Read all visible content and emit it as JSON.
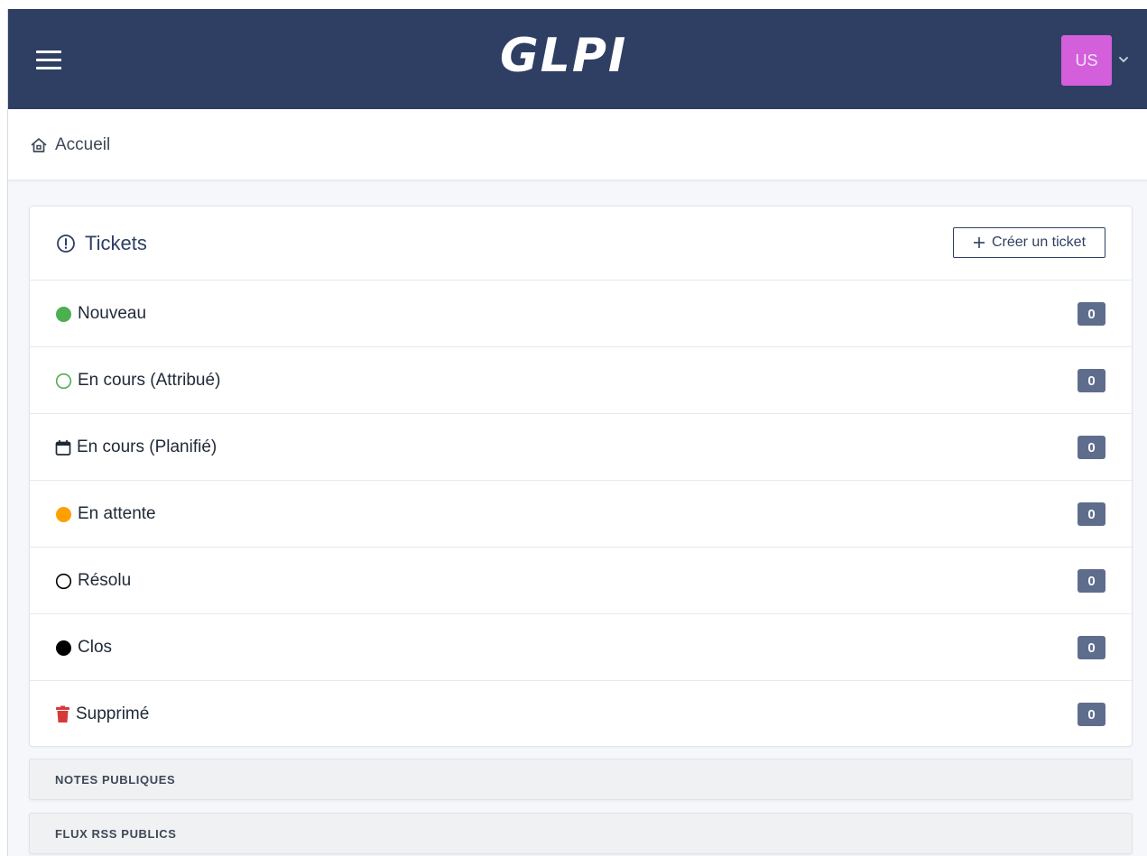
{
  "header": {
    "logo_text": "GLPI",
    "avatar_initials": "US",
    "colors": {
      "navbar": "#2f3f63",
      "avatar": "#d35fdb"
    }
  },
  "breadcrumb": {
    "home_label": "Accueil"
  },
  "tickets": {
    "title": "Tickets",
    "create_button_label": "Créer un ticket",
    "rows": [
      {
        "label": "Nouveau",
        "count": "0",
        "icon": "filled-green-circle-icon",
        "color": "#4caf50"
      },
      {
        "label": "En cours (Attribué)",
        "count": "0",
        "icon": "outline-green-circle-icon",
        "color": "#4caf50"
      },
      {
        "label": "En cours (Planifié)",
        "count": "0",
        "icon": "calendar-icon",
        "color": "#1f2937"
      },
      {
        "label": "En attente",
        "count": "0",
        "icon": "filled-orange-circle-icon",
        "color": "#ffa000"
      },
      {
        "label": "Résolu",
        "count": "0",
        "icon": "outline-black-circle-icon",
        "color": "#000000"
      },
      {
        "label": "Clos",
        "count": "0",
        "icon": "filled-black-circle-icon",
        "color": "#000000"
      },
      {
        "label": "Supprimé",
        "count": "0",
        "icon": "trash-icon",
        "color": "#d63939"
      }
    ]
  },
  "sections": [
    {
      "label": "NOTES PUBLIQUES"
    },
    {
      "label": "FLUX RSS PUBLICS"
    }
  ]
}
